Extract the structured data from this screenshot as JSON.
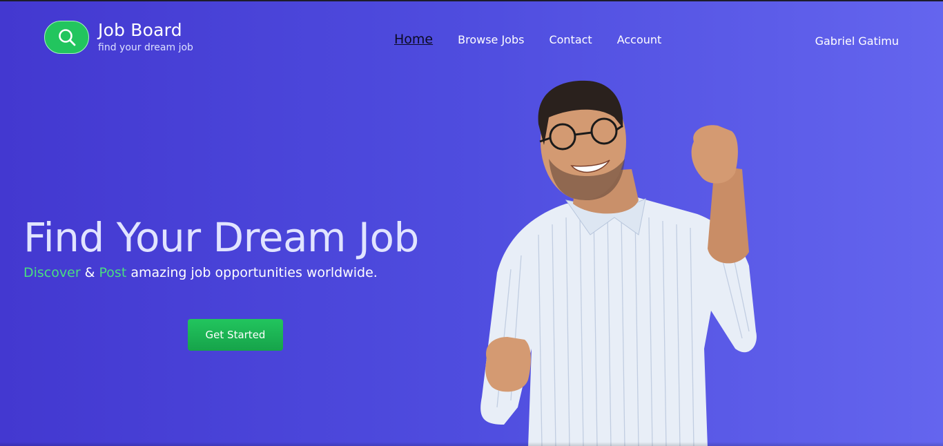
{
  "brand": {
    "title": "Job Board",
    "tagline": "find your dream job",
    "logo_icon": "search-icon",
    "logo_color": "#22c55e"
  },
  "nav": {
    "items": [
      {
        "label": "Home",
        "active": true
      },
      {
        "label": "Browse Jobs",
        "active": false
      },
      {
        "label": "Contact",
        "active": false
      },
      {
        "label": "Account",
        "active": false
      }
    ]
  },
  "user": {
    "name": "Gabriel Gatimu"
  },
  "hero": {
    "title": "Find Your Dream Job",
    "subtitle_part1": "Discover",
    "subtitle_amp": " & ",
    "subtitle_part2": "Post",
    "subtitle_rest": " amazing job opportunities worldwide.",
    "cta_label": "Get Started",
    "image": "smiling-man-cheering-photo"
  },
  "colors": {
    "background_start": "#4338d0",
    "background_end": "#6465ee",
    "accent_green": "#22c55e",
    "subtitle_accent": "#4ade80"
  }
}
